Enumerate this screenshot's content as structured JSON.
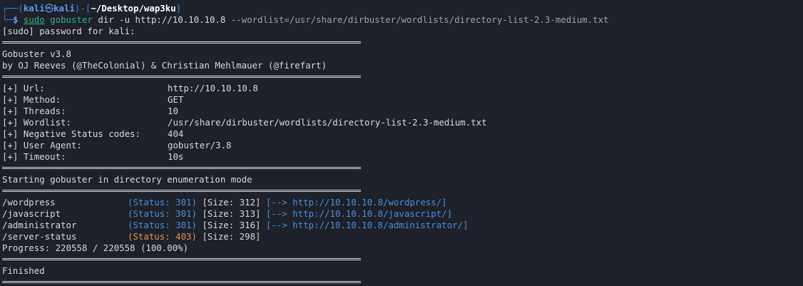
{
  "prompt": {
    "box_top": "┌──(",
    "user": "kali",
    "at": "㉿",
    "host": "kali",
    "mid": ")-[",
    "path": "~/Desktop/wap3ku",
    "close": "]",
    "box_bottom": "└─",
    "dollar": "$",
    "sudo": "sudo",
    "prog": "gobuster",
    "cmd_rest": " dir -u http://10.10.10.8 ",
    "arg": "--wordlist=/usr/share/dirbuster/wordlists/directory-list-2.3-medium.txt"
  },
  "sudo_prompt": "[sudo] password for kali:",
  "banner": {
    "title": "Gobuster v3.8",
    "credits": "by OJ Reeves (@TheColonial) & Christian Mehlmauer (@firefart)"
  },
  "config": [
    {
      "key": "[+] Url:",
      "value": "http://10.10.10.8"
    },
    {
      "key": "[+] Method:",
      "value": "GET"
    },
    {
      "key": "[+] Threads:",
      "value": "10"
    },
    {
      "key": "[+] Wordlist:",
      "value": "/usr/share/dirbuster/wordlists/directory-list-2.3-medium.txt"
    },
    {
      "key": "[+] Negative Status codes:",
      "value": "404"
    },
    {
      "key": "[+] User Agent:",
      "value": "gobuster/3.8"
    },
    {
      "key": "[+] Timeout:",
      "value": "10s"
    }
  ],
  "starting": "Starting gobuster in directory enumeration mode",
  "results": [
    {
      "path": "/wordpress",
      "status": "(Status: 301)",
      "size": "[Size: 312]",
      "redirect": "[--> http://10.10.10.8/wordpress/]",
      "status_color": "#4a8fd8"
    },
    {
      "path": "/javascript",
      "status": "(Status: 301)",
      "size": "[Size: 313]",
      "redirect": "[--> http://10.10.10.8/javascript/]",
      "status_color": "#4a8fd8"
    },
    {
      "path": "/administrator",
      "status": "(Status: 301)",
      "size": "[Size: 316]",
      "redirect": "[--> http://10.10.10.8/administrator/]",
      "status_color": "#4a8fd8"
    },
    {
      "path": "/server-status",
      "status": "(Status: 403)",
      "size": "[Size: 298]",
      "redirect": "",
      "status_color": "#e5904a"
    }
  ],
  "progress": "Progress: 220558 / 220558 (100.00%)",
  "finished": "Finished",
  "colors": {
    "background": "#1e2129",
    "text": "#d6d7da",
    "prompt_blue": "#3c7dd8",
    "status_301": "#4a8fd8",
    "status_403": "#e5904a"
  }
}
